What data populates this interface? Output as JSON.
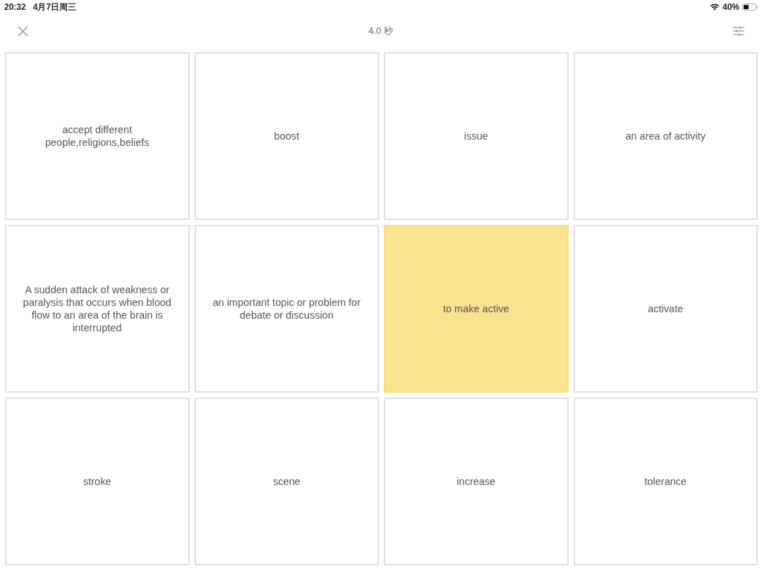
{
  "status_bar": {
    "time": "20:32",
    "date": "4月7日周三",
    "battery": "40%"
  },
  "header": {
    "timer": "4.0 秒"
  },
  "cards": [
    {
      "text": "accept different people,religions,beliefs",
      "selected": false
    },
    {
      "text": "boost",
      "selected": false
    },
    {
      "text": "issue",
      "selected": false
    },
    {
      "text": "an area of activity",
      "selected": false
    },
    {
      "text": "A sudden attack of weakness or paralysis that occurs when blood flow to an area of the brain is interrupted",
      "selected": false
    },
    {
      "text": "an important topic or problem for debate or discussion",
      "selected": false
    },
    {
      "text": "to make active",
      "selected": true
    },
    {
      "text": "activate",
      "selected": false
    },
    {
      "text": "stroke",
      "selected": false
    },
    {
      "text": "scene",
      "selected": false
    },
    {
      "text": "increase",
      "selected": false
    },
    {
      "text": "tolerance",
      "selected": false
    }
  ]
}
